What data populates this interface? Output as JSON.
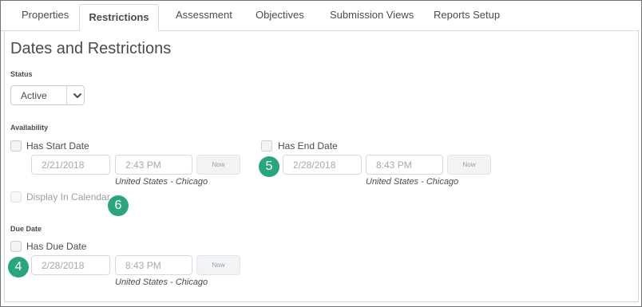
{
  "tabs": [
    {
      "label": "Properties"
    },
    {
      "label": "Restrictions"
    },
    {
      "label": "Assessment"
    },
    {
      "label": "Objectives"
    },
    {
      "label": "Submission Views"
    },
    {
      "label": "Reports Setup"
    }
  ],
  "active_tab": "Restrictions",
  "heading": "Dates and Restrictions",
  "status": {
    "label": "Status",
    "value": "Active"
  },
  "availability": {
    "label": "Availability",
    "start": {
      "checkbox_label": "Has Start Date",
      "date": "2/21/2018",
      "time": "2:43 PM",
      "now_label": "Now",
      "timezone": "United States - Chicago"
    },
    "end": {
      "checkbox_label": "Has End Date",
      "date": "2/28/2018",
      "time": "8:43 PM",
      "now_label": "Now",
      "timezone": "United States - Chicago"
    },
    "calendar_label": "Display In Calendar"
  },
  "due_date": {
    "label": "Due Date",
    "checkbox_label": "Has Due Date",
    "date": "2/28/2018",
    "time": "8:43 PM",
    "now_label": "Now",
    "timezone": "United States - Chicago"
  },
  "callouts": {
    "end": "5",
    "calendar": "6",
    "due": "4"
  },
  "colors": {
    "callout": "#2aa67a",
    "border": "#d3d9e3",
    "text": "#494c4e"
  }
}
